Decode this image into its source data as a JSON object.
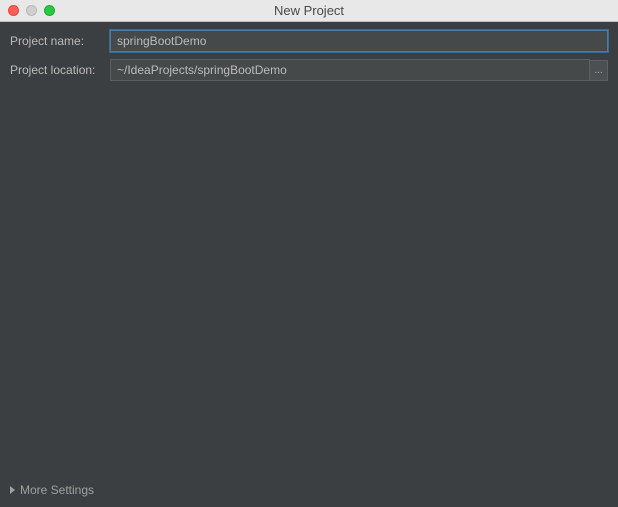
{
  "window": {
    "title": "New Project"
  },
  "form": {
    "projectName": {
      "label": "Project name:",
      "value": "springBootDemo"
    },
    "projectLocation": {
      "label": "Project location:",
      "value": "~/IdeaProjects/springBootDemo",
      "browseLabel": "..."
    }
  },
  "footer": {
    "moreSettingsLabel": "More Settings"
  }
}
